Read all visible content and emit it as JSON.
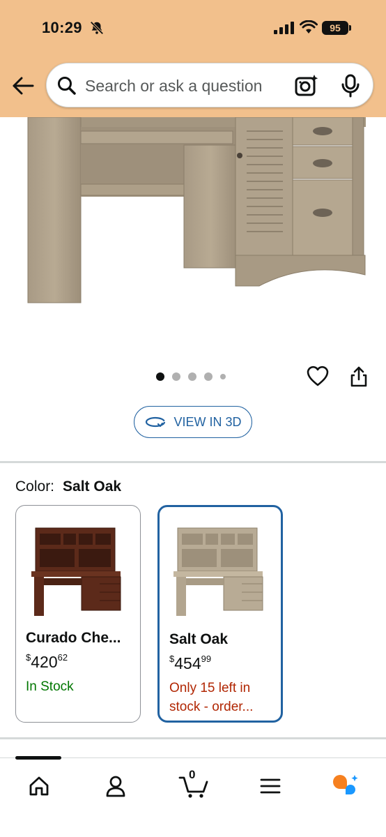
{
  "status_bar": {
    "time": "10:29",
    "battery": "95"
  },
  "search": {
    "placeholder": "Search or ask a question"
  },
  "gallery": {
    "image_count": 5,
    "active_index": 0
  },
  "view_3d": {
    "label": "VIEW IN 3D"
  },
  "color_selector": {
    "label": "Color:",
    "selected": "Salt Oak",
    "options": [
      {
        "name": "Curado Che...",
        "price_symbol": "$",
        "price_whole": "420",
        "price_fraction": "62",
        "availability": "In Stock",
        "selected": false
      },
      {
        "name": "Salt Oak",
        "price_symbol": "$",
        "price_whole": "454",
        "price_fraction": "99",
        "availability": "Only 15 left in stock - order...",
        "selected": true
      }
    ]
  },
  "bottom_nav": {
    "cart_count": "0",
    "items": [
      "home-icon",
      "account-icon",
      "cart-icon",
      "menu-icon",
      "rufus-icon"
    ]
  },
  "colors": {
    "header_bg": "#f2c08c",
    "link_blue": "#2162a1",
    "in_stock_green": "#007600",
    "low_stock_red": "#b12704"
  }
}
